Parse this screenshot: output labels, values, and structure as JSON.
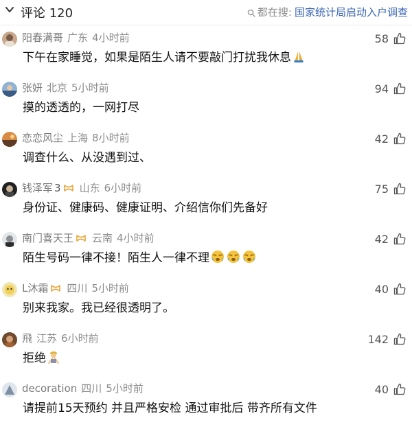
{
  "header": {
    "title": "评论 120",
    "search_prefix": "都在搜:",
    "search_hot": "国家统计局启动入户调查"
  },
  "comments": [
    {
      "name": "阳春满哥",
      "region": "广东",
      "time": "4小时前",
      "text": "下午在家睡觉，如果是陌生人请不要敲门打扰我休息",
      "likes": "58"
    },
    {
      "name": "张妍",
      "region": "北京",
      "time": "5小时前",
      "text": "摸的透透的，一网打尽",
      "likes": "94"
    },
    {
      "name": "恋恋风尘",
      "region": "上海",
      "time": "8小时前",
      "text": "调查什么、从没遇到过、",
      "likes": "42"
    },
    {
      "name": "钱泽军",
      "level": "3",
      "region": "山东",
      "time": "6小时前",
      "text": "身份证、健康码、健康证明、介绍信你们先备好",
      "likes": "75"
    },
    {
      "name": "南门喜天王",
      "region": "云南",
      "time": "4小时前",
      "text": "陌生号码一律不接！陌生人一律不理",
      "likes": "42"
    },
    {
      "name": "L沐霜",
      "region": "四川",
      "time": "5小时前",
      "text": "别来我家。我已经很透明了。",
      "likes": "40"
    },
    {
      "name": "飛",
      "region": "江苏",
      "time": "6小时前",
      "text": "拒绝",
      "likes": "142"
    },
    {
      "name": "decoration",
      "region": "四川",
      "time": "5小时前",
      "text": "请提前15天预约 并且严格安检 通过审批后 带齐所有文件",
      "likes": "40"
    }
  ]
}
